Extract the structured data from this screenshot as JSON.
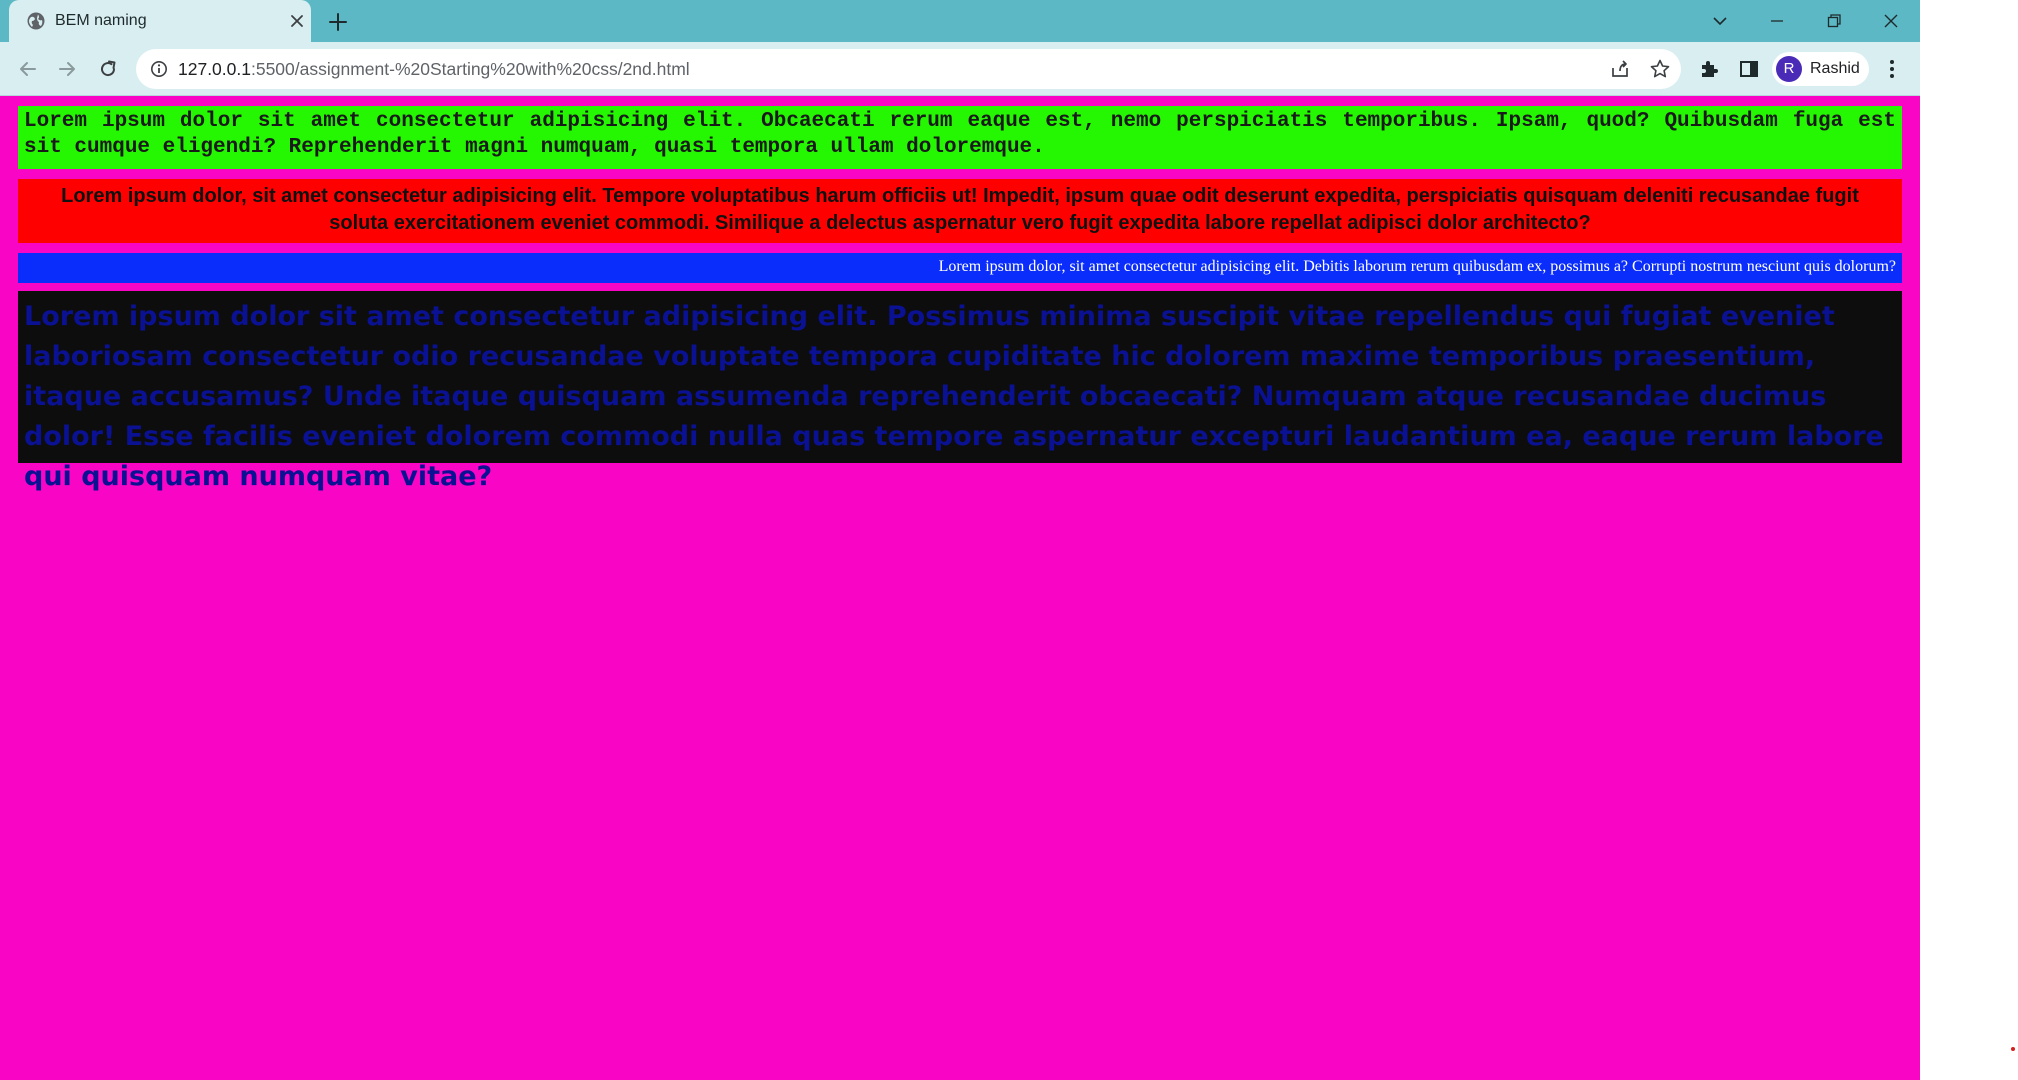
{
  "browser": {
    "tab": {
      "title": "BEM naming"
    },
    "address_bar": {
      "url_host": "127.0.0.1",
      "url_path": ":5500/assignment-%20Starting%20with%20css/2nd.html"
    },
    "profile": {
      "initial": "R",
      "name": "Rashid"
    },
    "colors": {
      "titlebar": "#5bb8c4",
      "toolbar": "#d8eef1",
      "avatar": "#4a2bb8"
    }
  },
  "page": {
    "background": "#f805c6",
    "boxes": [
      {
        "text": "Lorem ipsum dolor sit amet consectetur adipisicing elit. Obcaecati rerum eaque est, nemo perspiciatis temporibus. Ipsam, quod? Quibusdam fuga est sit cumque eligendi? Reprehenderit magni numquam, quasi tempora ullam doloremque.",
        "background": "#25f703"
      },
      {
        "text": "Lorem ipsum dolor, sit amet consectetur adipisicing elit. Tempore voluptatibus harum officiis ut! Impedit, ipsum quae odit deserunt expedita, perspiciatis quisquam deleniti recusandae fugit soluta exercitationem eveniet commodi. Similique a delectus aspernatur vero fugit expedita labore repellat adipisci dolor architecto?",
        "background": "#fe0000"
      },
      {
        "text": "Lorem ipsum dolor, sit amet consectetur adipisicing elit. Debitis laborum rerum quibusdam ex, possimus a? Corrupti nostrum nesciunt quis dolorum?",
        "background": "#0a2dfb"
      },
      {
        "text": "Lorem ipsum dolor sit amet consectetur adipisicing elit. Possimus minima suscipit vitae repellendus qui fugiat eveniet laboriosam consectetur odio recusandae voluptate tempora cupiditate hic dolorem maxime temporibus praesentium, itaque accusamus? Unde itaque quisquam assumenda reprehenderit obcaecati? Numquam atque recusandae ducimus dolor! Esse facilis eveniet dolorem commodi nulla quas tempore aspernatur excepturi laudantium ea, eaque rerum labore qui quisquam numquam vitae?",
        "background": "#0d0d0d"
      }
    ]
  },
  "icons": {
    "favicon": "globe-icon",
    "tab_close": "close-icon",
    "new_tab": "plus-icon",
    "tab_search": "chevron-down-icon",
    "minimize": "minimize-icon",
    "restore": "restore-icon",
    "close_window": "close-icon",
    "back": "arrow-left-icon",
    "forward": "arrow-right-icon",
    "reload": "reload-icon",
    "site_info": "info-icon",
    "share": "share-icon",
    "bookmark": "star-icon",
    "extensions": "puzzle-icon",
    "side_panel": "side-panel-icon",
    "menu": "kebab-menu-icon"
  }
}
